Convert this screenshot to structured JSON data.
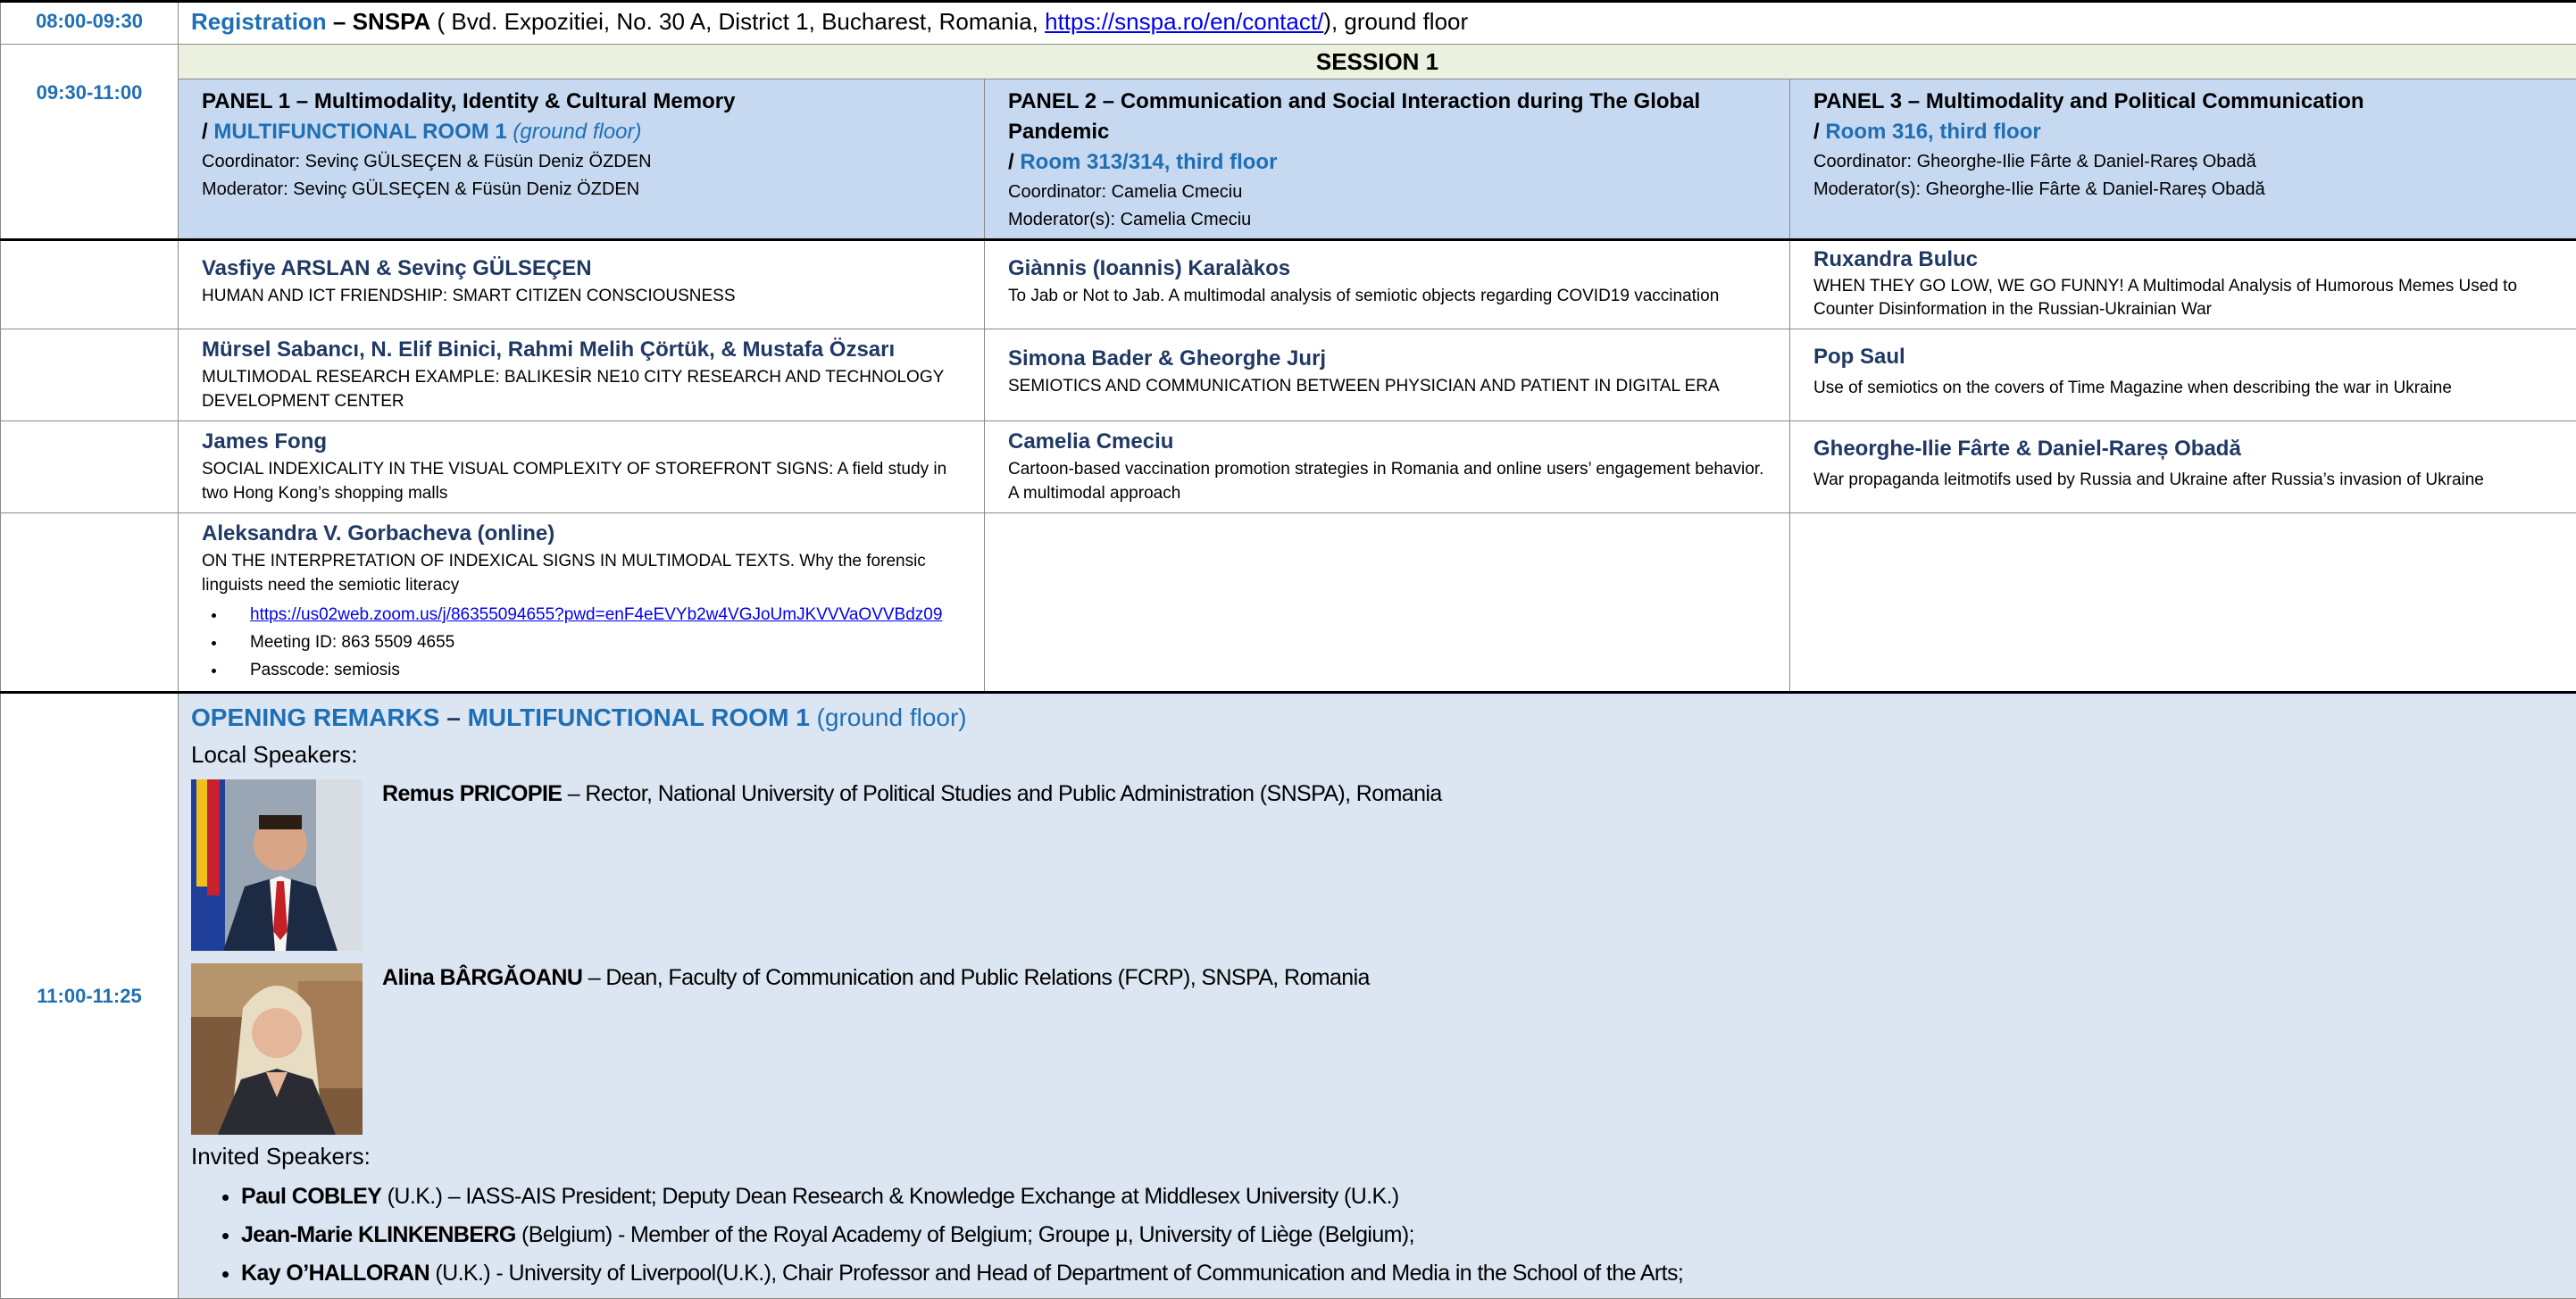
{
  "registration": {
    "time": "08:00-09:30",
    "label": "Registration",
    "dash": " – ",
    "venue": "SNSPA",
    "address": " ( Bvd. Expozitiei, No. 30 A, District 1, Bucharest, Romania, ",
    "url": "https://snspa.ro/en/contact/",
    "suffix": "), ground floor"
  },
  "session": {
    "title": "SESSION 1",
    "time": "09:30-11:00"
  },
  "panels": [
    {
      "title": "PANEL 1 – Multimodality, Identity & Cultural Memory",
      "room_prefix": "/ ",
      "room": "MULTIFUNCTIONAL ROOM 1",
      "room_note": " (ground floor)",
      "coordinator": "Coordinator: Sevinç GÜLSEÇEN & Füsün Deniz ÖZDEN",
      "moderator": "Moderator: Sevinç GÜLSEÇEN & Füsün Deniz ÖZDEN"
    },
    {
      "title": "PANEL 2 – Communication and Social Interaction during The Global Pandemic",
      "room_prefix": "/ ",
      "room": "Room 313/314, third floor",
      "room_note": "",
      "coordinator": "Coordinator: Camelia Cmeciu",
      "moderator": "Moderator(s): Camelia Cmeciu"
    },
    {
      "title": "PANEL 3 – Multimodality and Political Communication",
      "room_prefix": "/ ",
      "room": "Room 316, third floor",
      "room_note": "",
      "coordinator": "Coordinator: Gheorghe-Ilie Fârte & Daniel-Rareș Obadă",
      "moderator": "Moderator(s): Gheorghe-Ilie Fârte & Daniel-Rareș Obadă"
    }
  ],
  "papers": [
    [
      {
        "author": "Vasfiye ARSLAN & Sevinç GÜLSEÇEN",
        "title": "HUMAN AND ICT FRIENDSHIP: SMART CITIZEN CONSCIOUSNESS"
      },
      {
        "author": "Giànnis (Ioannis) Karalàkos",
        "title": "To Jab or Not to Jab. A multimodal analysis of semiotic objects regarding COVID19 vaccination"
      },
      {
        "author": "Ruxandra Buluc",
        "title": "WHEN THEY GO LOW, WE GO FUNNY! A Multimodal Analysis of Humorous Memes Used to Counter Disinformation in the Russian-Ukrainian War"
      }
    ],
    [
      {
        "author": "Mürsel Sabancı, N. Elif Binici, Rahmi Melih Çörtük, & Mustafa Özsarı",
        "title": "MULTIMODAL RESEARCH EXAMPLE: BALIKESİR NE10 CITY RESEARCH AND TECHNOLOGY DEVELOPMENT CENTER"
      },
      {
        "author": "Simona Bader & Gheorghe Jurj",
        "title": "SEMIOTICS AND COMMUNICATION BETWEEN PHYSICIAN AND PATIENT IN DIGITAL ERA"
      },
      {
        "author": "Pop Saul",
        "title": "Use of semiotics on the covers of Time Magazine when describing the war in Ukraine"
      }
    ],
    [
      {
        "author": "James Fong",
        "title": "SOCIAL INDEXICALITY IN THE VISUAL COMPLEXITY OF STOREFRONT SIGNS: A field study in two Hong Kong’s shopping malls"
      },
      {
        "author": "Camelia Cmeciu",
        "title": "Cartoon-based vaccination promotion strategies in Romania and online users’ engagement behavior. A multimodal approach"
      },
      {
        "author": "Gheorghe-Ilie Fârte & Daniel-Rareș Obadă",
        "title": "War propaganda leitmotifs used by Russia and Ukraine after Russia’s invasion of Ukraine"
      }
    ]
  ],
  "online_paper": {
    "author": "Aleksandra V. Gorbacheva (online)",
    "title": "ON THE INTERPRETATION OF INDEXICAL SIGNS IN MULTIMODAL TEXTS. Why the forensic linguists need the semiotic literacy",
    "zoom_link": "https://us02web.zoom.us/j/86355094655?pwd=enF4eEVYb2w4VGJoUmJKVVVaOVVBdz09",
    "meeting_id": "Meeting ID: 863 5509 4655",
    "passcode": "Passcode: semiosis"
  },
  "opening": {
    "time": "11:00-11:25",
    "title": "OPENING REMARKS",
    "dash": " – ",
    "room": "MULTIFUNCTIONAL ROOM 1",
    "room_note": " (ground floor)",
    "local_label": "Local Speakers:",
    "local_speakers": [
      {
        "name": "Remus PRICOPIE",
        "role": " – Rector, National University of Political Studies and Public Administration (SNSPA), Romania"
      },
      {
        "name": "Alina BÂRGĂOANU",
        "role": " – Dean, Faculty of Communication and Public Relations (FCRP), SNSPA, Romania"
      }
    ],
    "invited_label": "Invited Speakers:",
    "invited_speakers": [
      {
        "name": "Paul COBLEY",
        "role": "  (U.K.) – IASS-AIS President; Deputy Dean Research & Knowledge Exchange at Middlesex University (U.K.)"
      },
      {
        "name": "Jean-Marie KLINKENBERG",
        "role": " (Belgium) - Member of the Royal Academy of Belgium; Groupe μ, University of Liège (Belgium);"
      },
      {
        "name": "Kay O’HALLORAN",
        "role": " (U.K.) - University of Liverpool(U.K.), Chair Professor and Head of Department of Communication and Media in the School of the Arts;"
      }
    ]
  },
  "colors": {
    "accent": "#1f6fb5",
    "navy": "#1f3864",
    "panel_bg": "#c6d9f1",
    "session_bg": "#ebf1de",
    "opening_bg": "#dce6f2"
  }
}
